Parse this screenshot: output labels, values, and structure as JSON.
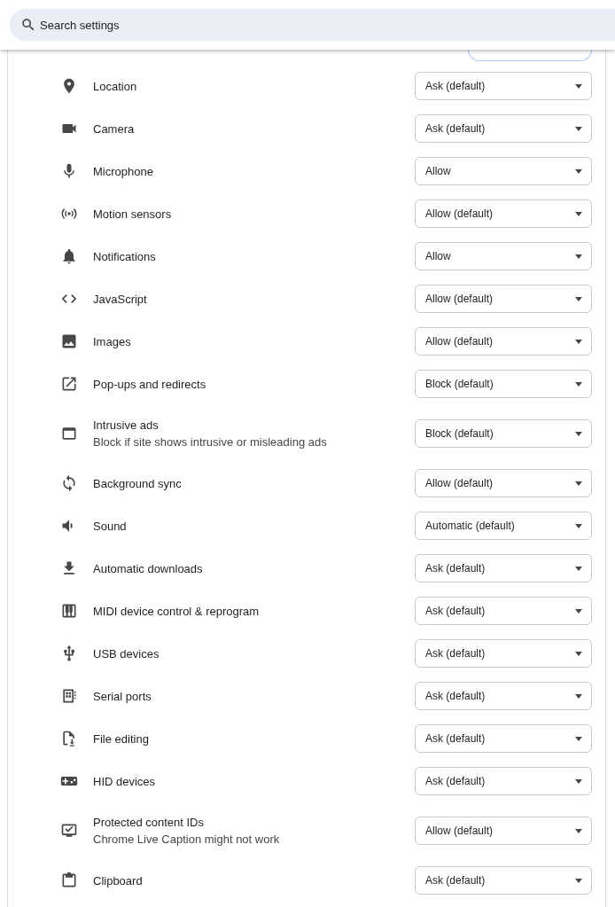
{
  "search": {
    "placeholder": "Search settings"
  },
  "permissions": [
    {
      "label": "Location",
      "value": "Ask (default)"
    },
    {
      "label": "Camera",
      "value": "Ask (default)"
    },
    {
      "label": "Microphone",
      "value": "Allow"
    },
    {
      "label": "Motion sensors",
      "value": "Allow (default)"
    },
    {
      "label": "Notifications",
      "value": "Allow"
    },
    {
      "label": "JavaScript",
      "value": "Allow (default)"
    },
    {
      "label": "Images",
      "value": "Allow (default)"
    },
    {
      "label": "Pop-ups and redirects",
      "value": "Block (default)"
    },
    {
      "label": "Intrusive ads",
      "description": "Block if site shows intrusive or misleading ads",
      "value": "Block (default)"
    },
    {
      "label": "Background sync",
      "value": "Allow (default)"
    },
    {
      "label": "Sound",
      "value": "Automatic (default)"
    },
    {
      "label": "Automatic downloads",
      "value": "Ask (default)"
    },
    {
      "label": "MIDI device control & reprogram",
      "value": "Ask (default)"
    },
    {
      "label": "USB devices",
      "value": "Ask (default)"
    },
    {
      "label": "Serial ports",
      "value": "Ask (default)"
    },
    {
      "label": "File editing",
      "value": "Ask (default)"
    },
    {
      "label": "HID devices",
      "value": "Ask (default)"
    },
    {
      "label": "Protected content IDs",
      "description": "Chrome Live Caption might not work",
      "value": "Allow (default)"
    },
    {
      "label": "Clipboard",
      "value": "Ask (default)"
    }
  ]
}
